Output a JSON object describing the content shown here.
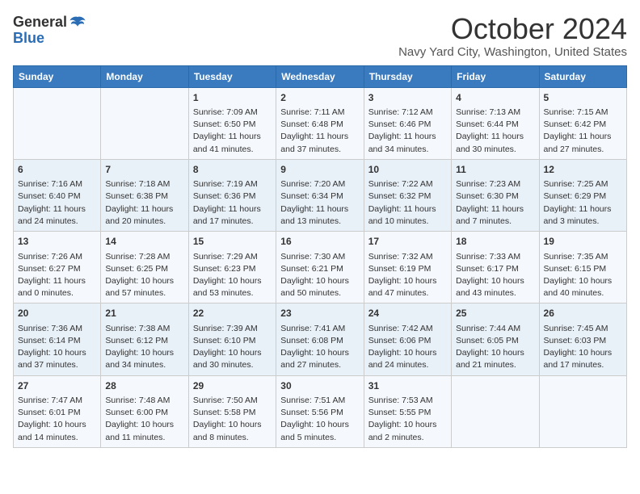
{
  "header": {
    "logo_general": "General",
    "logo_blue": "Blue",
    "month_title": "October 2024",
    "location": "Navy Yard City, Washington, United States"
  },
  "days_of_week": [
    "Sunday",
    "Monday",
    "Tuesday",
    "Wednesday",
    "Thursday",
    "Friday",
    "Saturday"
  ],
  "weeks": [
    [
      {
        "day": "",
        "info": ""
      },
      {
        "day": "",
        "info": ""
      },
      {
        "day": "1",
        "info": "Sunrise: 7:09 AM\nSunset: 6:50 PM\nDaylight: 11 hours and 41 minutes."
      },
      {
        "day": "2",
        "info": "Sunrise: 7:11 AM\nSunset: 6:48 PM\nDaylight: 11 hours and 37 minutes."
      },
      {
        "day": "3",
        "info": "Sunrise: 7:12 AM\nSunset: 6:46 PM\nDaylight: 11 hours and 34 minutes."
      },
      {
        "day": "4",
        "info": "Sunrise: 7:13 AM\nSunset: 6:44 PM\nDaylight: 11 hours and 30 minutes."
      },
      {
        "day": "5",
        "info": "Sunrise: 7:15 AM\nSunset: 6:42 PM\nDaylight: 11 hours and 27 minutes."
      }
    ],
    [
      {
        "day": "6",
        "info": "Sunrise: 7:16 AM\nSunset: 6:40 PM\nDaylight: 11 hours and 24 minutes."
      },
      {
        "day": "7",
        "info": "Sunrise: 7:18 AM\nSunset: 6:38 PM\nDaylight: 11 hours and 20 minutes."
      },
      {
        "day": "8",
        "info": "Sunrise: 7:19 AM\nSunset: 6:36 PM\nDaylight: 11 hours and 17 minutes."
      },
      {
        "day": "9",
        "info": "Sunrise: 7:20 AM\nSunset: 6:34 PM\nDaylight: 11 hours and 13 minutes."
      },
      {
        "day": "10",
        "info": "Sunrise: 7:22 AM\nSunset: 6:32 PM\nDaylight: 11 hours and 10 minutes."
      },
      {
        "day": "11",
        "info": "Sunrise: 7:23 AM\nSunset: 6:30 PM\nDaylight: 11 hours and 7 minutes."
      },
      {
        "day": "12",
        "info": "Sunrise: 7:25 AM\nSunset: 6:29 PM\nDaylight: 11 hours and 3 minutes."
      }
    ],
    [
      {
        "day": "13",
        "info": "Sunrise: 7:26 AM\nSunset: 6:27 PM\nDaylight: 11 hours and 0 minutes."
      },
      {
        "day": "14",
        "info": "Sunrise: 7:28 AM\nSunset: 6:25 PM\nDaylight: 10 hours and 57 minutes."
      },
      {
        "day": "15",
        "info": "Sunrise: 7:29 AM\nSunset: 6:23 PM\nDaylight: 10 hours and 53 minutes."
      },
      {
        "day": "16",
        "info": "Sunrise: 7:30 AM\nSunset: 6:21 PM\nDaylight: 10 hours and 50 minutes."
      },
      {
        "day": "17",
        "info": "Sunrise: 7:32 AM\nSunset: 6:19 PM\nDaylight: 10 hours and 47 minutes."
      },
      {
        "day": "18",
        "info": "Sunrise: 7:33 AM\nSunset: 6:17 PM\nDaylight: 10 hours and 43 minutes."
      },
      {
        "day": "19",
        "info": "Sunrise: 7:35 AM\nSunset: 6:15 PM\nDaylight: 10 hours and 40 minutes."
      }
    ],
    [
      {
        "day": "20",
        "info": "Sunrise: 7:36 AM\nSunset: 6:14 PM\nDaylight: 10 hours and 37 minutes."
      },
      {
        "day": "21",
        "info": "Sunrise: 7:38 AM\nSunset: 6:12 PM\nDaylight: 10 hours and 34 minutes."
      },
      {
        "day": "22",
        "info": "Sunrise: 7:39 AM\nSunset: 6:10 PM\nDaylight: 10 hours and 30 minutes."
      },
      {
        "day": "23",
        "info": "Sunrise: 7:41 AM\nSunset: 6:08 PM\nDaylight: 10 hours and 27 minutes."
      },
      {
        "day": "24",
        "info": "Sunrise: 7:42 AM\nSunset: 6:06 PM\nDaylight: 10 hours and 24 minutes."
      },
      {
        "day": "25",
        "info": "Sunrise: 7:44 AM\nSunset: 6:05 PM\nDaylight: 10 hours and 21 minutes."
      },
      {
        "day": "26",
        "info": "Sunrise: 7:45 AM\nSunset: 6:03 PM\nDaylight: 10 hours and 17 minutes."
      }
    ],
    [
      {
        "day": "27",
        "info": "Sunrise: 7:47 AM\nSunset: 6:01 PM\nDaylight: 10 hours and 14 minutes."
      },
      {
        "day": "28",
        "info": "Sunrise: 7:48 AM\nSunset: 6:00 PM\nDaylight: 10 hours and 11 minutes."
      },
      {
        "day": "29",
        "info": "Sunrise: 7:50 AM\nSunset: 5:58 PM\nDaylight: 10 hours and 8 minutes."
      },
      {
        "day": "30",
        "info": "Sunrise: 7:51 AM\nSunset: 5:56 PM\nDaylight: 10 hours and 5 minutes."
      },
      {
        "day": "31",
        "info": "Sunrise: 7:53 AM\nSunset: 5:55 PM\nDaylight: 10 hours and 2 minutes."
      },
      {
        "day": "",
        "info": ""
      },
      {
        "day": "",
        "info": ""
      }
    ]
  ]
}
